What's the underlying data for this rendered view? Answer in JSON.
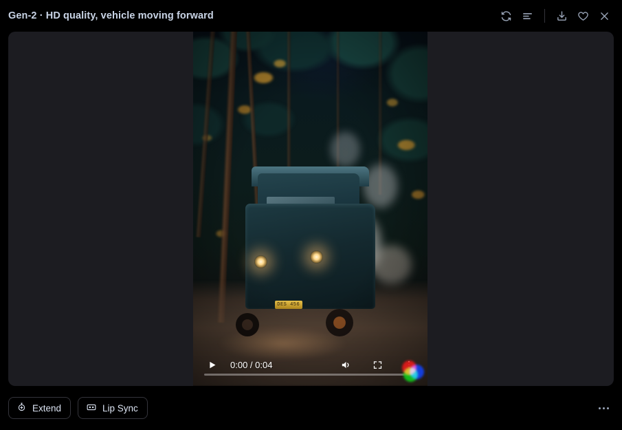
{
  "window": {
    "background_color": "#000000",
    "panel_color": "#1c1c21"
  },
  "header": {
    "title": "Gen-2 · HD quality, vehicle moving forward",
    "actions": [
      {
        "name": "refresh-icon",
        "label": "Regenerate"
      },
      {
        "name": "list-icon",
        "label": "Details"
      },
      {
        "name": "download-icon",
        "label": "Download"
      },
      {
        "name": "heart-icon",
        "label": "Favorite"
      },
      {
        "name": "close-icon",
        "label": "Close"
      }
    ]
  },
  "video": {
    "current_time": "0:00",
    "duration": "0:04",
    "time_display": "0:00 / 0:04",
    "progress_percent": 0,
    "play_state": "paused",
    "muted": false,
    "controls": [
      {
        "name": "play-button",
        "label": "Play"
      },
      {
        "name": "volume-button",
        "label": "Mute"
      },
      {
        "name": "fullscreen-button",
        "label": "Full screen"
      },
      {
        "name": "video-options-button",
        "label": "More options"
      }
    ],
    "scene": {
      "description": "Vintage car driving forward on a dirt road through a dark forest with headlights on and dust trailing behind",
      "license_plate_text": "DES 456"
    }
  },
  "toolbar": {
    "buttons": [
      {
        "name": "extend-button",
        "label": "Extend",
        "icon": "stopwatch-plus-icon"
      },
      {
        "name": "lip-sync-button",
        "label": "Lip Sync",
        "icon": "mouth-icon"
      }
    ],
    "more_label": "More"
  }
}
